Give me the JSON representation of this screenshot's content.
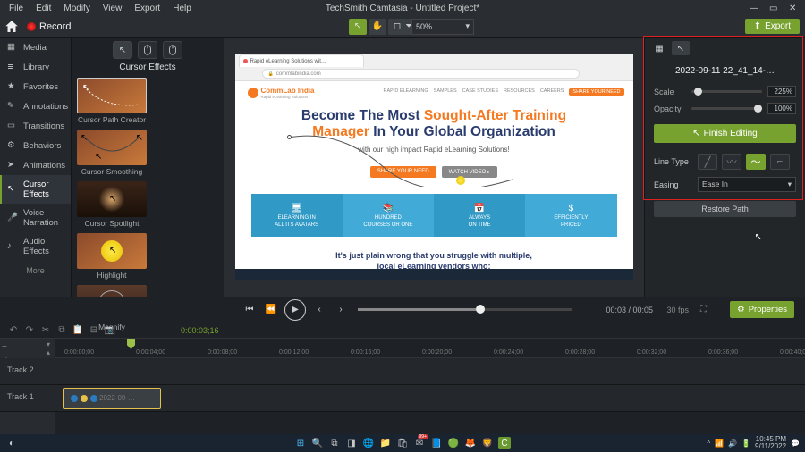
{
  "menu": {
    "items": [
      "File",
      "Edit",
      "Modify",
      "View",
      "Export",
      "Help"
    ],
    "title": "TechSmith Camtasia - Untitled Project*"
  },
  "toolbar": {
    "record": "Record",
    "zoom": "50%",
    "export": "Export"
  },
  "mediabin": {
    "items": [
      {
        "icon": "▦",
        "label": "Media"
      },
      {
        "icon": "≣",
        "label": "Library"
      },
      {
        "icon": "★",
        "label": "Favorites"
      },
      {
        "icon": "✎",
        "label": "Annotations"
      },
      {
        "icon": "▭",
        "label": "Transitions"
      },
      {
        "icon": "⚙",
        "label": "Behaviors"
      },
      {
        "icon": "➤",
        "label": "Animations"
      },
      {
        "icon": "↖",
        "label": "Cursor Effects"
      },
      {
        "icon": "🎤",
        "label": "Voice Narration"
      },
      {
        "icon": "♪",
        "label": "Audio Effects"
      }
    ],
    "more": "More",
    "active": 7
  },
  "effects": {
    "title": "Cursor Effects",
    "items": [
      "Cursor Path Creator",
      "Cursor Smoothing",
      "Cursor Spotlight",
      "Highlight",
      "Magnify"
    ]
  },
  "preview": {
    "tab": "Rapid eLearning Solutions wit…",
    "url": "commlabindia.com",
    "logo": "CommLab India",
    "logo_sub": "Rapid eLearning Solutions",
    "nav": [
      "RAPID ELEARNING",
      "SAMPLES",
      "CASE STUDIES",
      "RESOURCES",
      "CAREERS"
    ],
    "nav_cta": "SHARE YOUR NEED",
    "hero1_a": "Become The Most ",
    "hero1_b": "Sought-After Training",
    "hero2_a": "Manager ",
    "hero2_b": "In Your Global Organization",
    "sub": "with our high impact Rapid eLearning Solutions!",
    "btn1": "SHARE YOUR NEED",
    "btn2": "WATCH VIDEO",
    "tiles": [
      {
        "ic": "🖥",
        "l1": "ELEARNING IN",
        "l2": "ALL ITS AVATARS"
      },
      {
        "ic": "📚",
        "l1": "HUNDRED",
        "l2": "COURSES OR ONE"
      },
      {
        "ic": "📅",
        "l1": "ALWAYS",
        "l2": "ON TIME"
      },
      {
        "ic": "$",
        "l1": "EFFICIENTLY",
        "l2": "PRICED"
      }
    ],
    "bottom1": "It's just plain wrong that you struggle with multiple,",
    "bottom2": "local eLearning vendors who:"
  },
  "props": {
    "name": "2022-09-11 22_41_14-…",
    "scale": {
      "label": "Scale",
      "value": "225%",
      "pos": 8
    },
    "opacity": {
      "label": "Opacity",
      "value": "100%",
      "pos": 100
    },
    "finish": "Finish Editing",
    "linetype": "Line Type",
    "easing_label": "Easing",
    "easing_value": "Ease In",
    "restore": "Restore Path"
  },
  "playbar": {
    "time": "00:03 / 00:05",
    "fps": "30 fps",
    "props_btn": "Properties"
  },
  "timeline": {
    "playhead": "0:00:03;16",
    "ticks": [
      "0:00:00;00",
      "0:00:04;00",
      "0:00:08;00",
      "0:00:12;00",
      "0:00:16;00",
      "0:00:20;00",
      "0:00:24;00",
      "0:00:28;00",
      "0:00:32;00",
      "0:00:36;00",
      "0:00:40;00"
    ],
    "tracks": [
      "Track 2",
      "Track 1"
    ],
    "clip_name": "2022-09-…"
  },
  "taskbar": {
    "time": "10:45 PM",
    "date": "9/11/2022"
  }
}
